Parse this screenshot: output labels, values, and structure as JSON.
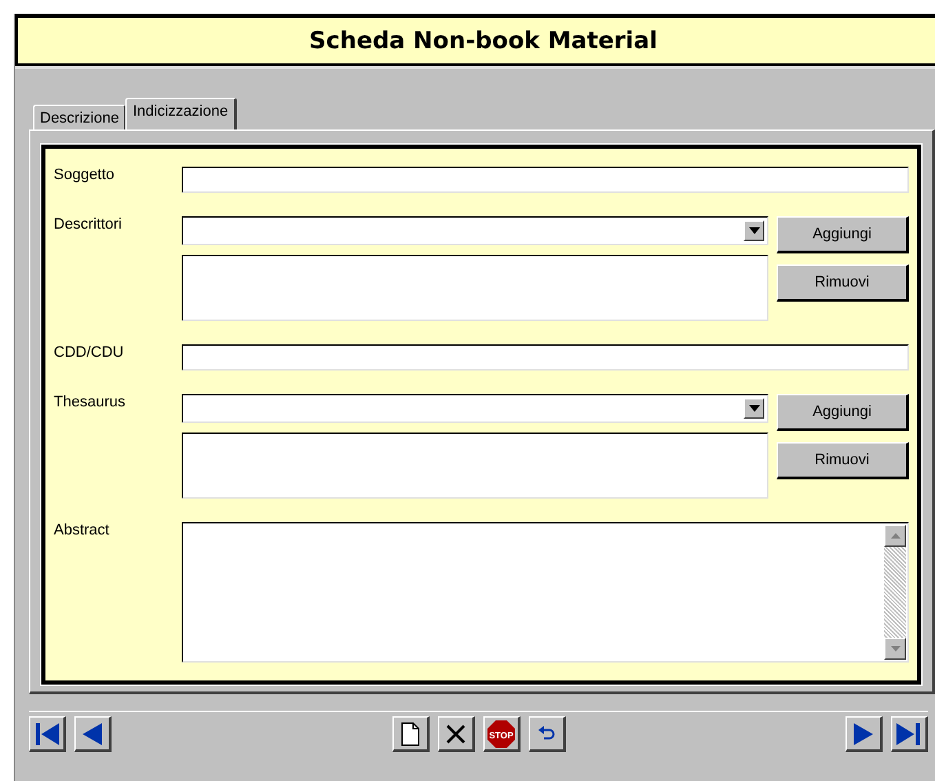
{
  "window": {
    "title": "Scheda Non-book Material"
  },
  "tabs": [
    {
      "label": "Descrizione",
      "selected": false
    },
    {
      "label": "Indicizzazione",
      "selected": true
    }
  ],
  "fields": [
    {
      "kind": "text",
      "label": "Soggetto"
    },
    {
      "kind": "combo-list",
      "label": "Descrittori",
      "add_button": "Aggiungi",
      "remove_button": "Rimuovi"
    },
    {
      "kind": "text",
      "label": "CDD/CDU"
    },
    {
      "kind": "combo-list",
      "label": "Thesaurus",
      "add_button": "Aggiungi",
      "remove_button": "Rimuovi"
    },
    {
      "kind": "textarea",
      "label": "Abstract"
    }
  ],
  "toolbar": {
    "left": [
      {
        "kind": "first"
      },
      {
        "kind": "previous"
      }
    ],
    "center": [
      {
        "kind": "new"
      },
      {
        "kind": "delete"
      },
      {
        "kind": "stop",
        "label": "STOP"
      },
      {
        "kind": "undo"
      }
    ],
    "right": [
      {
        "kind": "next"
      },
      {
        "kind": "last"
      }
    ]
  }
}
